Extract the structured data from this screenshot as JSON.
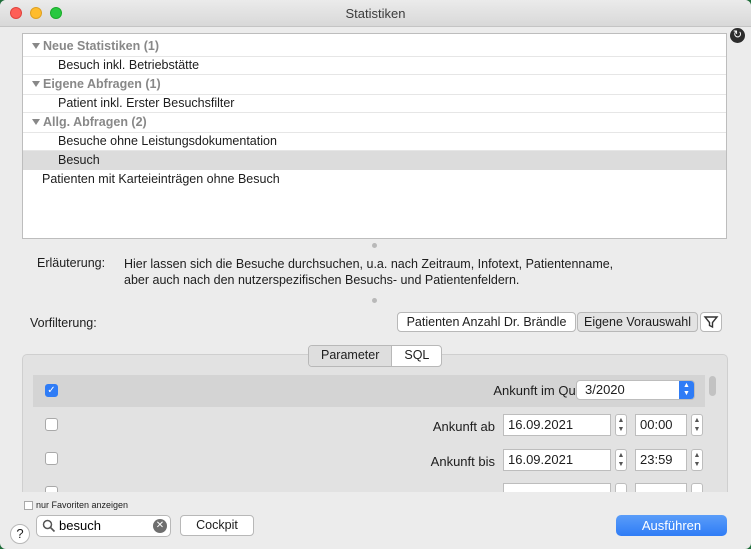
{
  "window": {
    "title": "Statistiken"
  },
  "list": {
    "rows": [
      {
        "label": "Neue Statistiken (1)",
        "kind": "group"
      },
      {
        "label": "Besuch inkl. Betriebstätte",
        "kind": "item"
      },
      {
        "label": "Eigene Abfragen (1)",
        "kind": "group"
      },
      {
        "label": "Patient inkl. Erster Besuchsfilter",
        "kind": "item"
      },
      {
        "label": "Allg. Abfragen (2)",
        "kind": "group"
      },
      {
        "label": "Besuche ohne Leistungsdokumentation",
        "kind": "item"
      },
      {
        "label": "Besuch",
        "kind": "item",
        "selected": true
      },
      {
        "label": "Patienten mit Karteieinträgen ohne Besuch",
        "kind": "item"
      }
    ]
  },
  "description": {
    "label": "Erläuterung:",
    "text_line1": "Hier lassen sich die Besuche durchsuchen, u.a. nach Zeitraum, Infotext, Patientenname,",
    "text_line2": "aber auch nach den nutzerspezifischen Besuchs- und Patientenfeldern."
  },
  "prefilter": {
    "label": "Vorfilterung:",
    "button1": "Patienten Anzahl Dr. Brändle",
    "button2": "Eigene Vorauswahl"
  },
  "tabs": {
    "parameter": "Parameter",
    "sql": "SQL",
    "active": "Parameter"
  },
  "params": {
    "quarter_label": "Ankunft im Quartal",
    "quarter_value": "3/2020",
    "from_label": "Ankunft ab",
    "from_date": "16.09.2021",
    "from_time": "00:00",
    "to_label": "Ankunft bis",
    "to_date": "16.09.2021",
    "to_time": "23:59"
  },
  "footer": {
    "favorites_label": "nur Favoriten anzeigen",
    "help": "?",
    "search_value": "besuch",
    "cockpit": "Cockpit",
    "run": "Ausführen"
  },
  "colors": {
    "accent": "#2f7cf6",
    "selection": "#dcdcdc"
  }
}
